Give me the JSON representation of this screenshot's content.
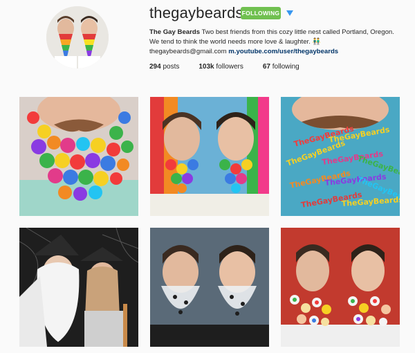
{
  "profile": {
    "username": "thegaybeards",
    "follow_button_label": "FOLLOWING",
    "display_name": "The Gay Beards",
    "bio_text": "Two best friends from this cozy little nest called Portland, Oregon. We tend to think the world needs more love & laughter. 👬",
    "email": "thegaybeards@gmail.com",
    "website": "m.youtube.com/user/thegaybeards"
  },
  "stats": {
    "posts_count": "294",
    "posts_label": "posts",
    "followers_count": "103k",
    "followers_label": "followers",
    "following_count": "67",
    "following_label": "following"
  },
  "grid": {
    "tile3_word": "TheGayBeards"
  },
  "colors": {
    "follow_green": "#70c050",
    "link_blue": "#003569",
    "dropdown_blue": "#3897f0"
  },
  "icons": {
    "dropdown": "chevron-down-icon"
  }
}
